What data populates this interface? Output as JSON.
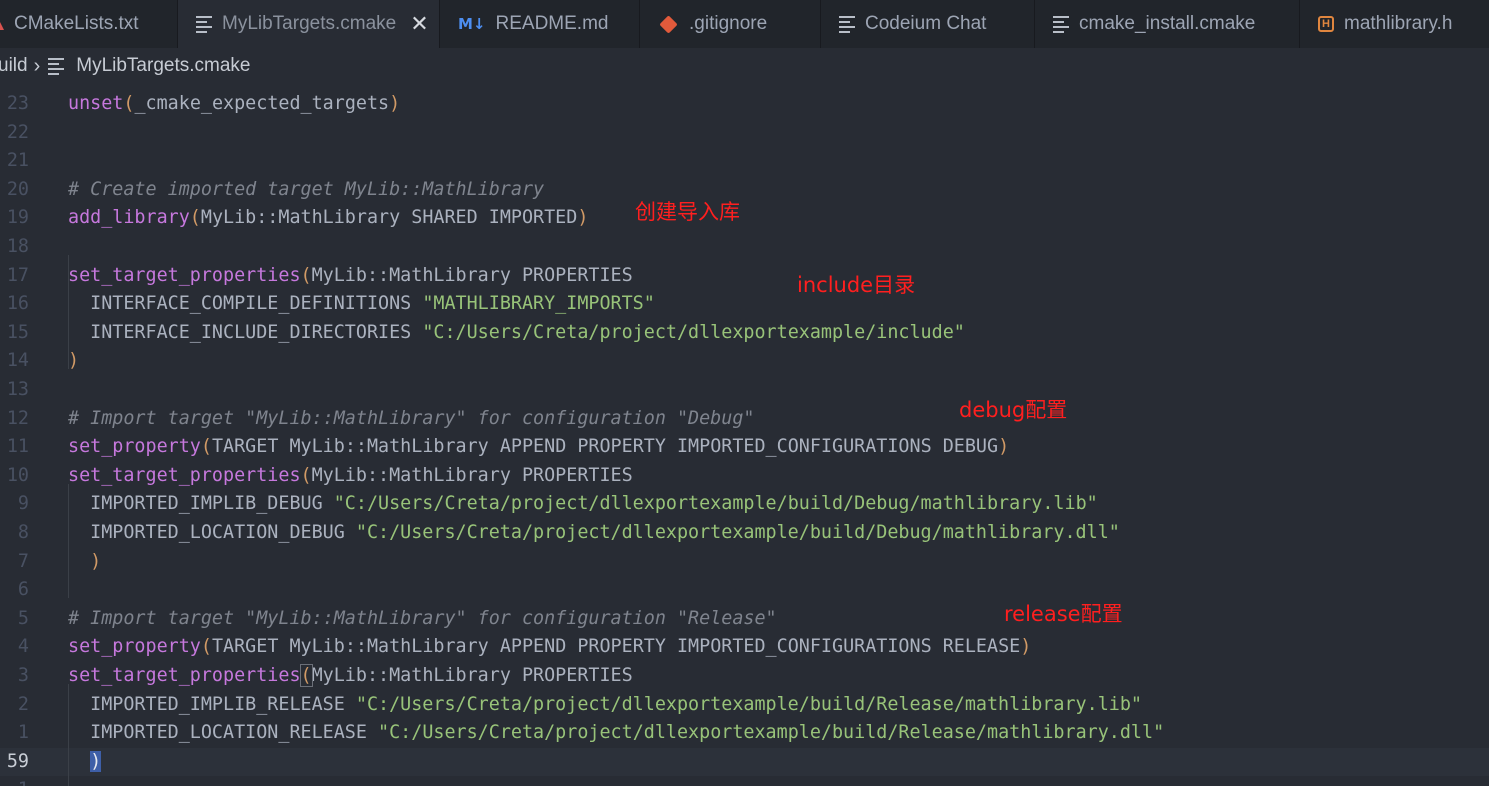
{
  "tabs": [
    {
      "label": "CMakeLists.txt",
      "icon": "cmake-icon",
      "active": false
    },
    {
      "label": "MyLibTargets.cmake",
      "icon": "text-lines-icon",
      "active": true
    },
    {
      "label": "README.md",
      "icon": "markdown-icon",
      "active": false
    },
    {
      "label": ".gitignore",
      "icon": "git-icon",
      "active": false
    },
    {
      "label": "Codeium Chat",
      "icon": "text-lines-icon",
      "active": false
    },
    {
      "label": "cmake_install.cmake",
      "icon": "text-lines-icon",
      "active": false
    },
    {
      "label": "mathlibrary.h",
      "icon": "header-file-icon",
      "active": false
    }
  ],
  "tab_close_glyph": "✕",
  "breadcrumb": {
    "folder": "uild",
    "file": "MyLibTargets.cmake"
  },
  "editor": {
    "lines": [
      {
        "num": "23",
        "segments": [
          [
            "kw",
            "unset"
          ],
          [
            "pn",
            "("
          ],
          [
            "id",
            "_cmake_expected_targets"
          ],
          [
            "pn",
            ")"
          ]
        ]
      },
      {
        "num": "22",
        "segments": []
      },
      {
        "num": "21",
        "segments": []
      },
      {
        "num": "20",
        "segments": [
          [
            "cm",
            "# Create imported target MyLib::MathLibrary"
          ]
        ]
      },
      {
        "num": "19",
        "segments": [
          [
            "fn",
            "add_library"
          ],
          [
            "pn",
            "("
          ],
          [
            "id",
            "MyLib::MathLibrary SHARED IMPORTED"
          ],
          [
            "pn",
            ")"
          ]
        ]
      },
      {
        "num": "18",
        "segments": []
      },
      {
        "num": "17",
        "segments": [
          [
            "fn",
            "set_target_properties"
          ],
          [
            "pn",
            "("
          ],
          [
            "id",
            "MyLib::MathLibrary PROPERTIES"
          ]
        ]
      },
      {
        "num": "16",
        "segments": [
          [
            "id",
            "  INTERFACE_COMPILE_DEFINITIONS "
          ],
          [
            "str",
            "\"MATHLIBRARY_IMPORTS\""
          ]
        ]
      },
      {
        "num": "15",
        "segments": [
          [
            "id",
            "  INTERFACE_INCLUDE_DIRECTORIES "
          ],
          [
            "str",
            "\"C:/Users/Creta/project/dllexportexample/include\""
          ]
        ]
      },
      {
        "num": "14",
        "segments": [
          [
            "pn",
            ")"
          ]
        ]
      },
      {
        "num": "13",
        "segments": []
      },
      {
        "num": "12",
        "segments": [
          [
            "cm",
            "# Import target \"MyLib::MathLibrary\" for configuration \"Debug\""
          ]
        ]
      },
      {
        "num": "11",
        "segments": [
          [
            "fn",
            "set_property"
          ],
          [
            "pn",
            "("
          ],
          [
            "id",
            "TARGET MyLib::MathLibrary APPEND PROPERTY IMPORTED_CONFIGURATIONS DEBUG"
          ],
          [
            "pn",
            ")"
          ]
        ]
      },
      {
        "num": "10",
        "segments": [
          [
            "fn",
            "set_target_properties"
          ],
          [
            "pn",
            "("
          ],
          [
            "id",
            "MyLib::MathLibrary PROPERTIES"
          ]
        ]
      },
      {
        "num": "9",
        "segments": [
          [
            "id",
            "  IMPORTED_IMPLIB_DEBUG "
          ],
          [
            "str",
            "\"C:/Users/Creta/project/dllexportexample/build/Debug/mathlibrary.lib\""
          ]
        ]
      },
      {
        "num": "8",
        "segments": [
          [
            "id",
            "  IMPORTED_LOCATION_DEBUG "
          ],
          [
            "str",
            "\"C:/Users/Creta/project/dllexportexample/build/Debug/mathlibrary.dll\""
          ]
        ]
      },
      {
        "num": "7",
        "segments": [
          [
            "id",
            "  "
          ],
          [
            "pn",
            ")"
          ]
        ]
      },
      {
        "num": "6",
        "segments": []
      },
      {
        "num": "5",
        "segments": [
          [
            "cm",
            "# Import target \"MyLib::MathLibrary\" for configuration \"Release\""
          ]
        ]
      },
      {
        "num": "4",
        "segments": [
          [
            "fn",
            "set_property"
          ],
          [
            "pn",
            "("
          ],
          [
            "id",
            "TARGET MyLib::MathLibrary APPEND PROPERTY IMPORTED_CONFIGURATIONS RELEASE"
          ],
          [
            "pn",
            ")"
          ]
        ]
      },
      {
        "num": "3",
        "segments": [
          [
            "fn",
            "set_target_properties"
          ],
          [
            "match",
            "("
          ],
          [
            "id",
            "MyLib::MathLibrary PROPERTIES"
          ]
        ]
      },
      {
        "num": "2",
        "segments": [
          [
            "id",
            "  IMPORTED_IMPLIB_RELEASE "
          ],
          [
            "str",
            "\"C:/Users/Creta/project/dllexportexample/build/Release/mathlibrary.lib\""
          ]
        ]
      },
      {
        "num": "1",
        "segments": [
          [
            "id",
            "  IMPORTED_LOCATION_RELEASE "
          ],
          [
            "str",
            "\"C:/Users/Creta/project/dllexportexample/build/Release/mathlibrary.dll\""
          ]
        ]
      },
      {
        "num": "59",
        "current": true,
        "segments": [
          [
            "id",
            "  "
          ],
          [
            "sel",
            ")"
          ]
        ]
      },
      {
        "num": "1",
        "segments": []
      }
    ]
  },
  "annotations": {
    "create_import_lib": "创建导入库",
    "include_dir": "include目录",
    "debug_config": "debug配置",
    "release_config": "release配置"
  },
  "colors": {
    "keyword": "#c678dd",
    "string": "#98c379",
    "comment": "#7f848e",
    "paren": "#d19a66",
    "annotation": "#ff1f1f"
  }
}
